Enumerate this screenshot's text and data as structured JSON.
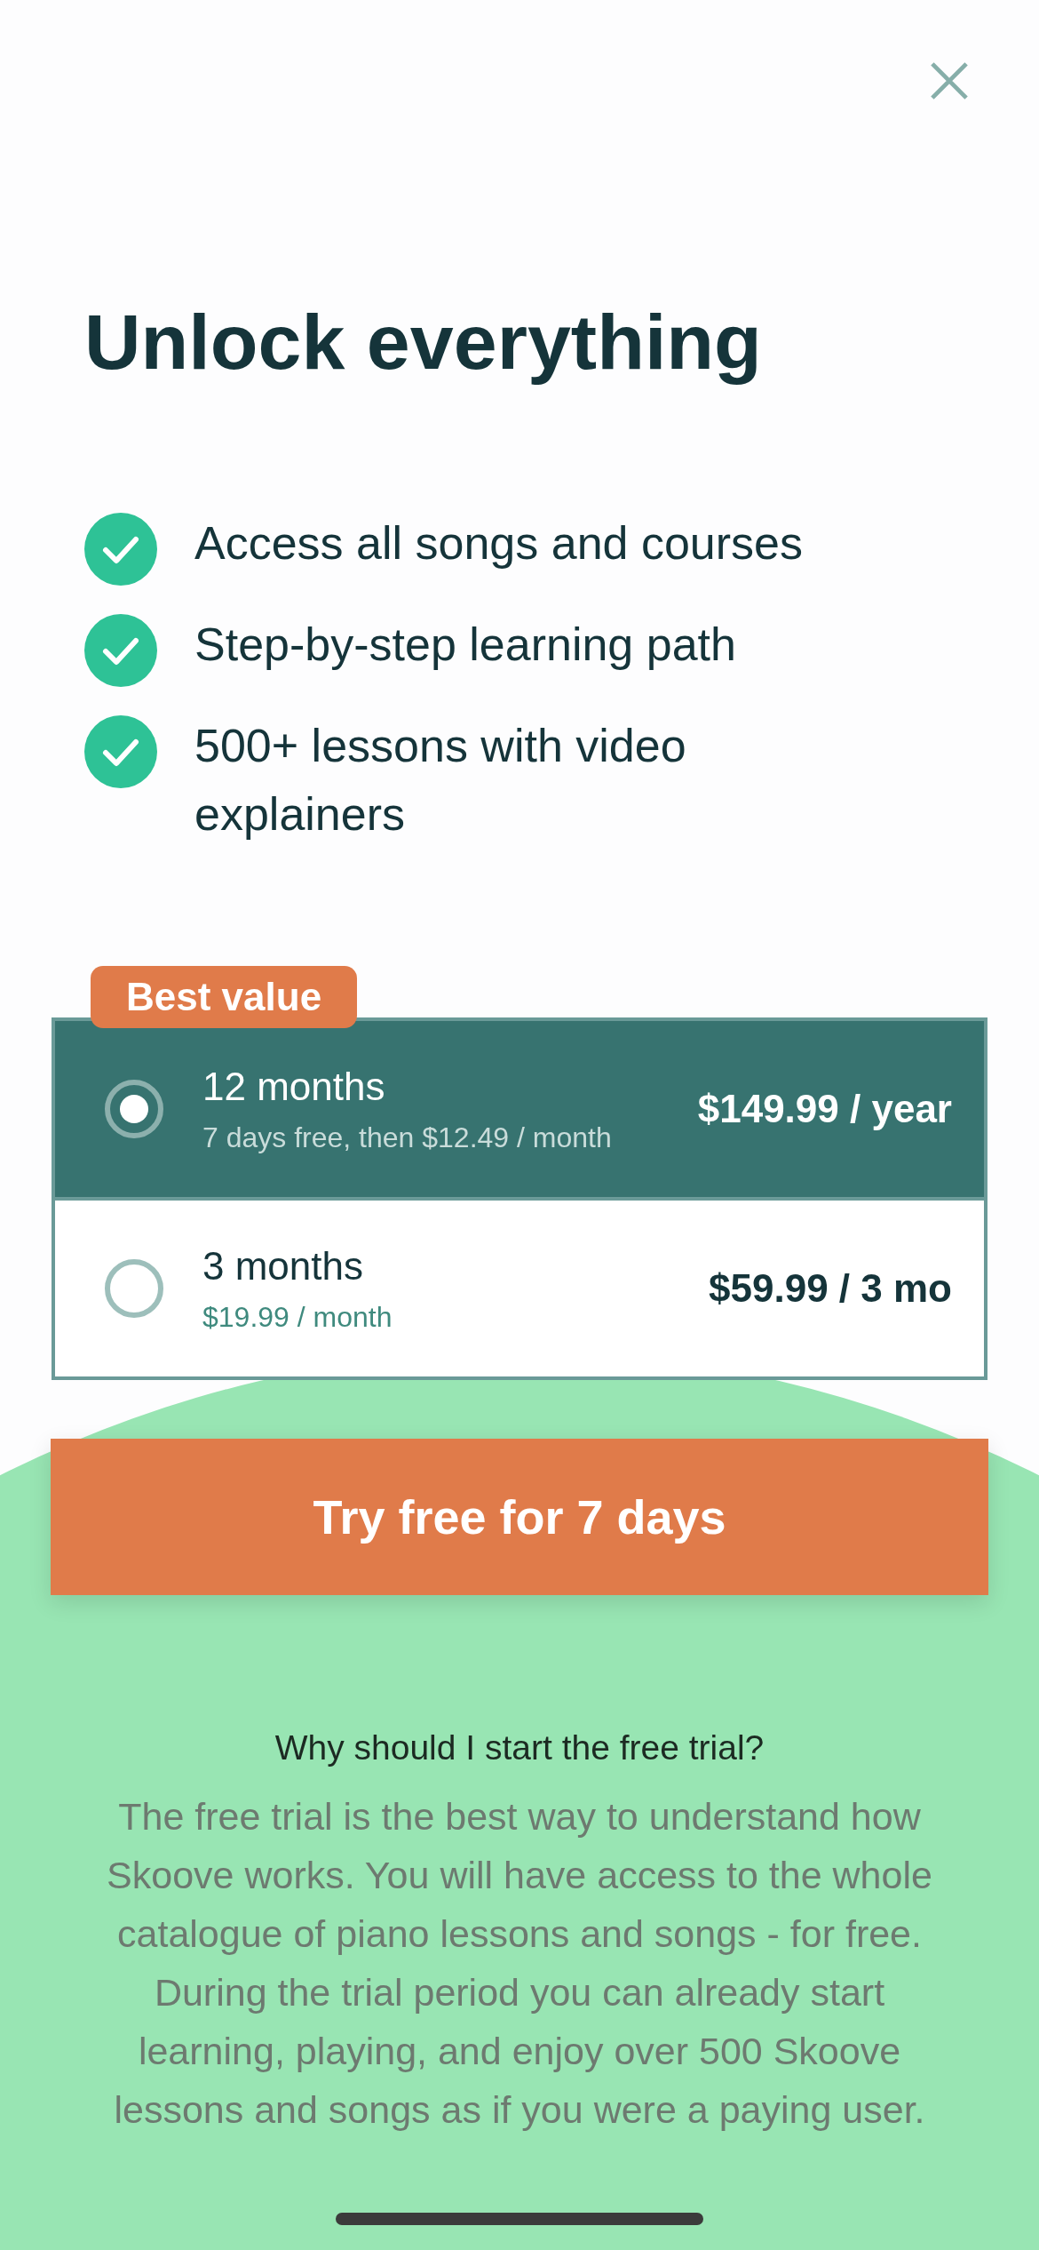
{
  "title": "Unlock everything",
  "features": [
    {
      "text": "Access all songs and courses"
    },
    {
      "text": "Step-by-step learning path"
    },
    {
      "text": "500+ lessons with video explainers"
    }
  ],
  "plans": [
    {
      "badge": "Best value",
      "name": "12 months",
      "detail": "7 days free, then $12.49 / month",
      "price": "$149.99 / year",
      "selected": true
    },
    {
      "name": "3 months",
      "detail": "$19.99 / month",
      "price": "$59.99 / 3 mo",
      "selected": false
    }
  ],
  "cta": "Try free for 7 days",
  "faq": {
    "question": "Why should I start the free trial?",
    "answer": "The free trial is the best way to understand how Skoove works. You will have access to the whole catalogue of piano lessons and songs - for free. During the trial period you can already start learning, playing, and enjoy over 500 Skoove lessons and songs as if you were a paying user."
  }
}
